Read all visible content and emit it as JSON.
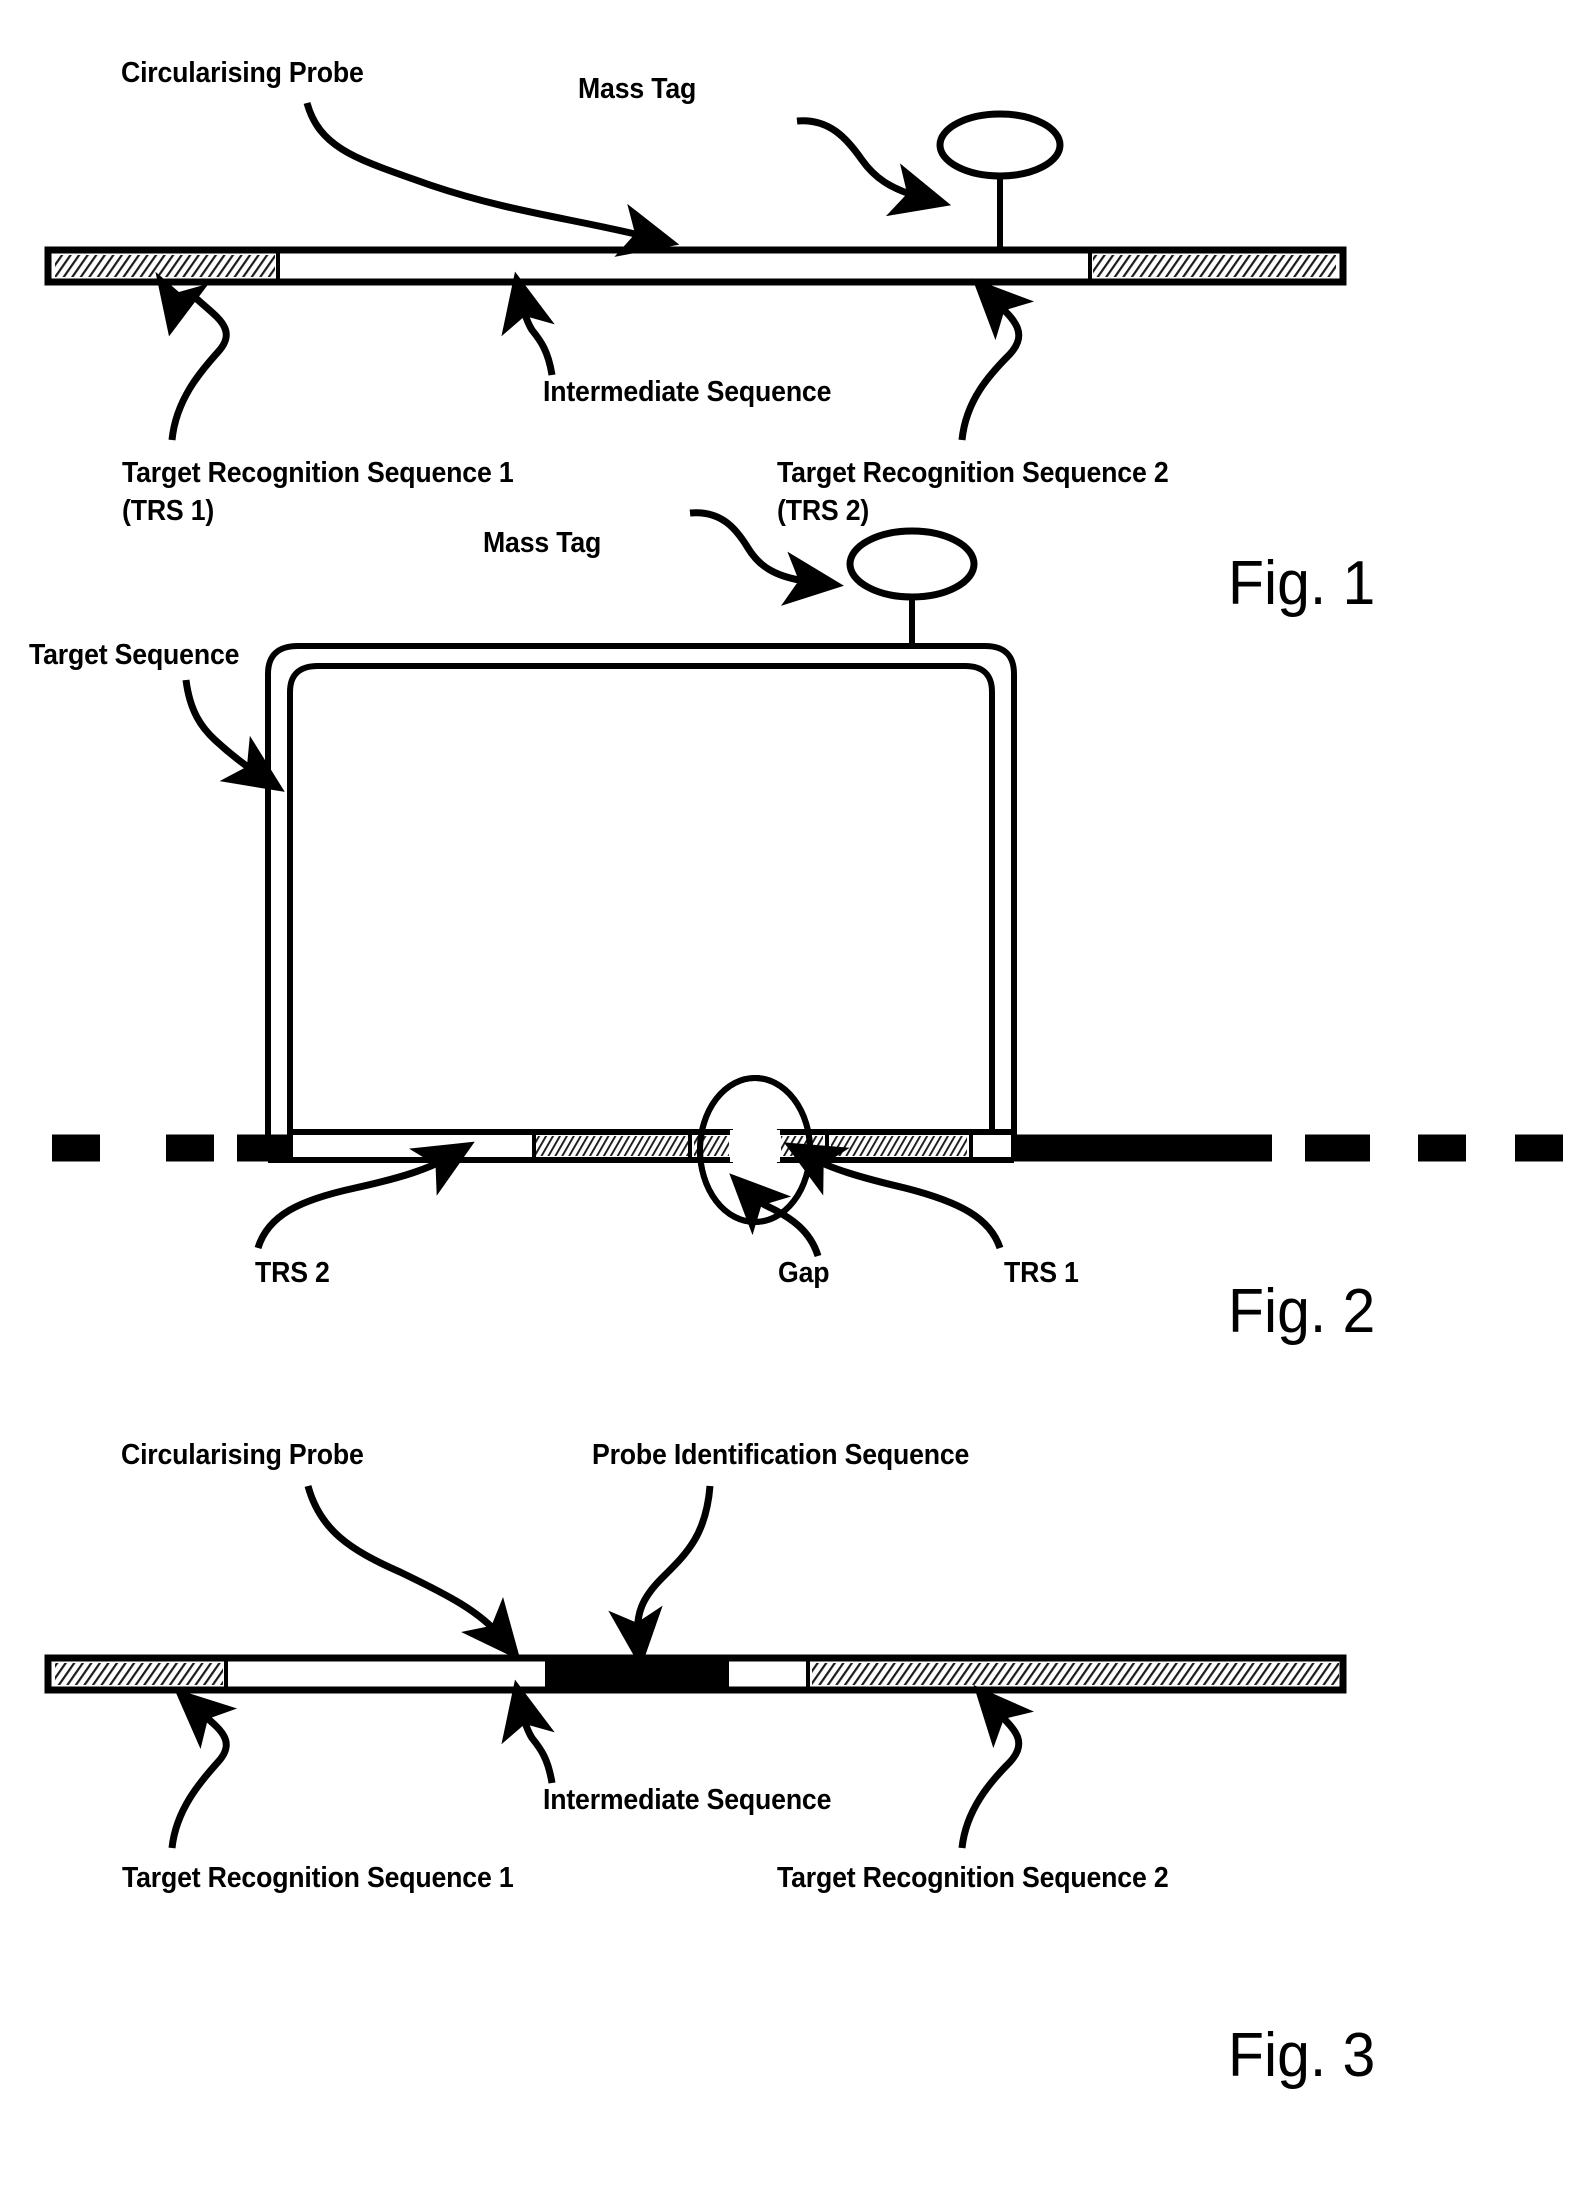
{
  "document": {
    "type": "patent-figure-sheet",
    "figure_count": 3
  },
  "figure1": {
    "caption": "Fig. 1",
    "labels": {
      "circularising_probe": "Circularising Probe",
      "mass_tag": "Mass Tag",
      "intermediate_sequence": "Intermediate Sequence",
      "trs1_line1": "Target Recognition Sequence 1",
      "trs1_line2": "(TRS 1)",
      "trs2_line1": "Target Recognition Sequence 2",
      "trs2_line2": "(TRS 2)"
    },
    "segments": [
      {
        "name": "target-recognition-sequence-1",
        "fill": "hatched"
      },
      {
        "name": "intermediate-sequence",
        "fill": "white"
      },
      {
        "name": "target-recognition-sequence-2",
        "fill": "hatched"
      }
    ]
  },
  "figure2": {
    "caption": "Fig. 2",
    "labels": {
      "mass_tag": "Mass Tag",
      "target_sequence": "Target Sequence",
      "trs2": "TRS 2",
      "gap": "Gap",
      "trs1": "TRS 1"
    },
    "elements": [
      {
        "name": "circularised-probe-loop",
        "shape": "rounded-rectangle-double-outline"
      },
      {
        "name": "mass-tag-ellipse",
        "shape": "ellipse-on-stalk"
      },
      {
        "name": "target-sequence-strand",
        "shape": "thick-dashed-line"
      },
      {
        "name": "gap-magnifier",
        "shape": "ellipse-outline"
      }
    ]
  },
  "figure3": {
    "caption": "Fig. 3",
    "labels": {
      "circularising_probe": "Circularising Probe",
      "probe_identification_sequence": "Probe Identification Sequence",
      "intermediate_sequence": "Intermediate Sequence",
      "trs1": "Target Recognition Sequence 1",
      "trs2": "Target Recognition Sequence 2"
    },
    "segments": [
      {
        "name": "target-recognition-sequence-1",
        "fill": "hatched"
      },
      {
        "name": "intermediate-sequence",
        "fill": "white"
      },
      {
        "name": "probe-identification-sequence",
        "fill": "black"
      },
      {
        "name": "spacer",
        "fill": "white"
      },
      {
        "name": "target-recognition-sequence-2",
        "fill": "hatched"
      }
    ]
  },
  "colors": {
    "ink": "#000000",
    "paper": "#ffffff"
  }
}
